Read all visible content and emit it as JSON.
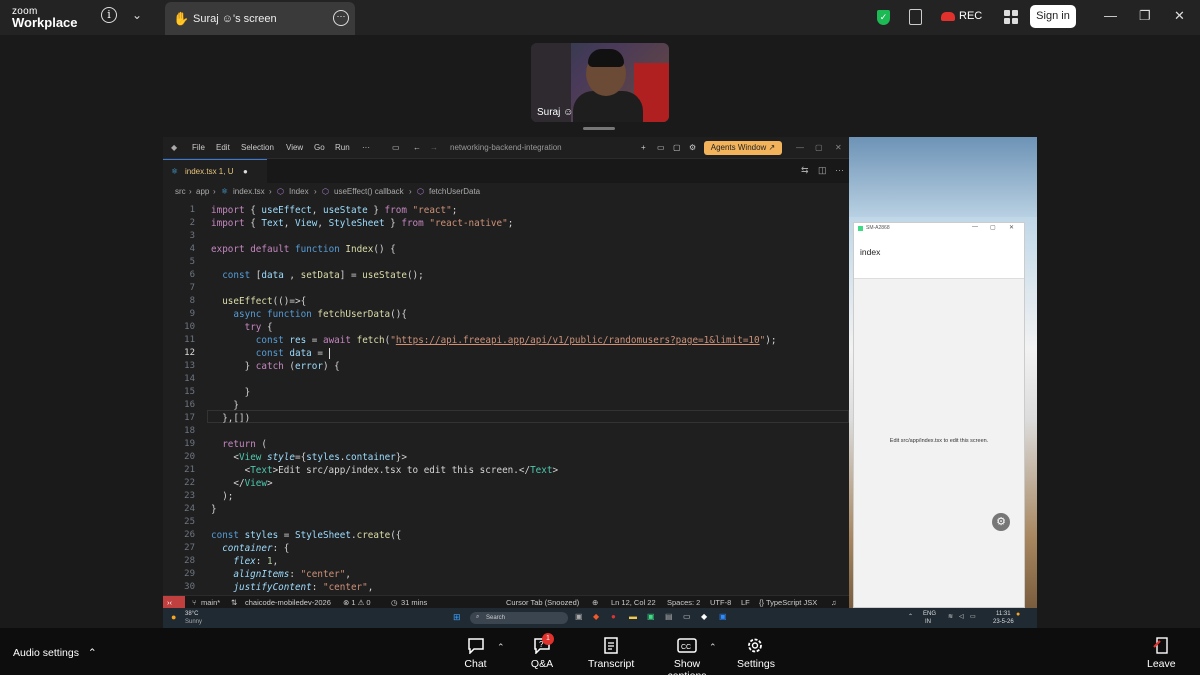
{
  "zoom": {
    "logo_line1": "zoom",
    "logo_line2": "Workplace",
    "tab_label": "Suraj ☺'s screen",
    "rec_label": "REC",
    "sign_in": "Sign in",
    "participant_name": "Suraj ☺"
  },
  "vscode": {
    "menu": [
      "File",
      "Edit",
      "Selection",
      "View",
      "Go",
      "Run",
      "···"
    ],
    "project": "networking-backend-integration",
    "agents_button": "Agents Window ↗",
    "tab_label": "index.tsx 1, U",
    "breadcrumb": [
      "src",
      "app",
      "index.tsx",
      "Index",
      "useEffect() callback",
      "fetchUserData"
    ],
    "current_line": 12,
    "status": {
      "branch": "main*",
      "workspace": "chaicode-mobiledev-2026",
      "problems": "⊗ 1 ⚠ 0",
      "time": "31 mins",
      "cursor_tab": "Cursor Tab (Snoozed)",
      "position": "Ln 12, Col 22",
      "spaces": "Spaces: 2",
      "encoding": "UTF-8",
      "eol": "LF",
      "language": "{} TypeScript JSX"
    }
  },
  "emulator": {
    "device": "SM-A2868",
    "app_title": "index",
    "body_text": "Edit src/app/index.tsx to edit this screen."
  },
  "taskbar": {
    "weather_temp": "38°C",
    "weather_desc": "Sunny",
    "search": "Search",
    "lang": "ENG",
    "region": "IN",
    "time": "11:31",
    "date": "23-5-26"
  },
  "bottom": {
    "audio_settings": "Audio settings",
    "chat": "Chat",
    "qa": "Q&A",
    "qa_badge": "1",
    "transcript": "Transcript",
    "captions": "Show captions",
    "settings": "Settings",
    "leave": "Leave"
  },
  "colors": {
    "agents_button": "#f3b35b",
    "leave": "#e0312d",
    "shield": "#1db954"
  }
}
